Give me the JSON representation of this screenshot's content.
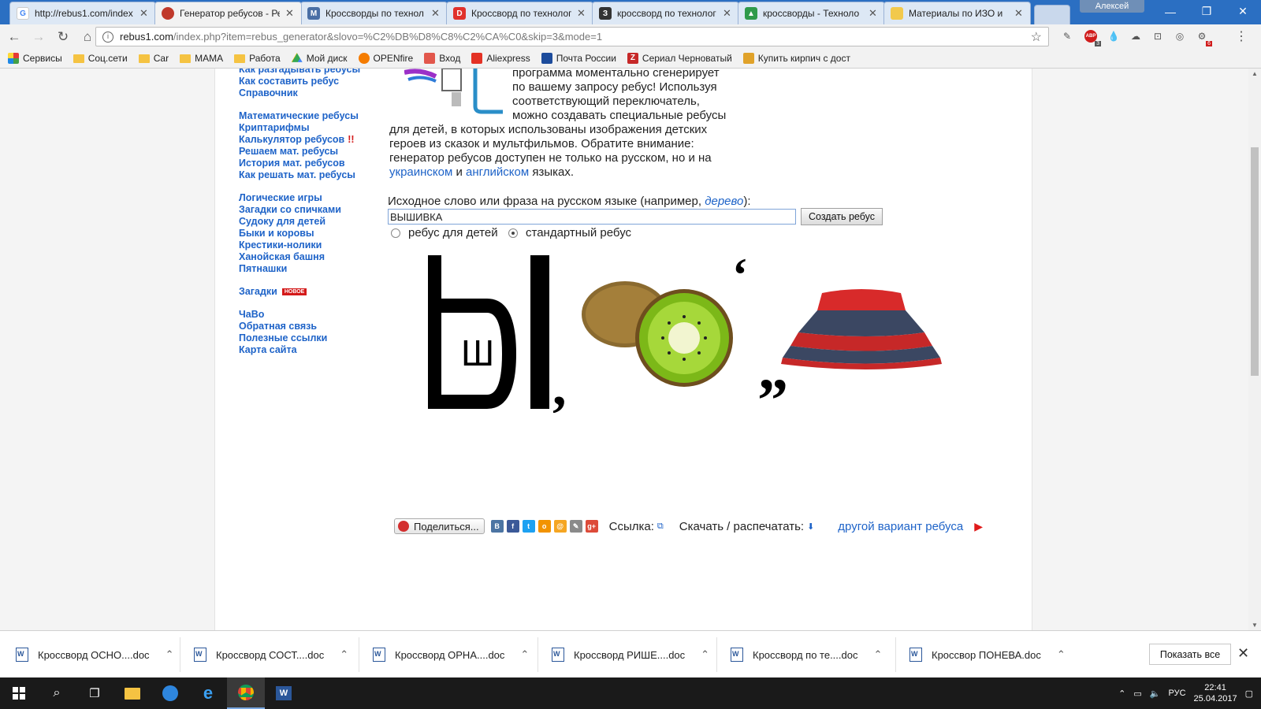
{
  "tabs": [
    {
      "title": "http://rebus1.com/index",
      "icon": "google-icon",
      "color": "#4285f4"
    },
    {
      "title": "Генератор ребусов - Ре",
      "icon": "rebus-site-icon",
      "color": "#c0392b"
    },
    {
      "title": "Кроссворды по технол",
      "icon": "m-site-icon",
      "color": "#4a6fa5"
    },
    {
      "title": "Кроссворд по технолог",
      "icon": "d-site-icon",
      "color": "#e0312c"
    },
    {
      "title": "кроссворд по технолог",
      "icon": "z-site-icon",
      "color": "#333333"
    },
    {
      "title": "кроссворды - Техноло",
      "icon": "triangle-site-icon",
      "color": "#2f9a4b"
    },
    {
      "title": "Материалы по ИЗО и",
      "icon": "doc-site-icon",
      "color": "#f2c94c"
    }
  ],
  "window": {
    "user": "Алексей"
  },
  "address": {
    "host": "rebus1.com",
    "rest": "/index.php?item=rebus_generator&slovo=%C2%DB%D8%C8%C2%CA%C0&skip=3&mode=1"
  },
  "bookmarks": [
    {
      "label": "Сервисы",
      "icon": "apps-icon"
    },
    {
      "label": "Соц.сети",
      "icon": "folder-icon"
    },
    {
      "label": "Car",
      "icon": "folder-icon"
    },
    {
      "label": "MAMA",
      "icon": "folder-icon"
    },
    {
      "label": "Работа",
      "icon": "folder-icon"
    },
    {
      "label": "Мой диск",
      "icon": "drive-icon"
    },
    {
      "label": "OPENfire",
      "icon": "fire-icon"
    },
    {
      "label": "Вход",
      "icon": "mail-icon"
    },
    {
      "label": "Aliexpress",
      "icon": "ali-icon"
    },
    {
      "label": "Почта России",
      "icon": "eagle-icon"
    },
    {
      "label": "Сериал Черноватый",
      "icon": "z-icon"
    },
    {
      "label": "Купить кирпич с дост",
      "icon": "brick-icon"
    }
  ],
  "extensions": {
    "abp_count": "3",
    "badge_count": "6"
  },
  "nav": {
    "group1": [
      "Как разгадывать ребусы",
      "Как составить ребус",
      "Справочник"
    ],
    "group2": [
      "Математические ребусы",
      "Криптарифмы",
      "Калькулятор ребусов",
      "Решаем мат. ребусы",
      "История мат. ребусов",
      "Как решать мат. ребусы"
    ],
    "calc_mark": "!!",
    "group3": [
      "Логические игры",
      "Загадки со спичками",
      "Судоку для детей",
      "Быки и коровы",
      "Крестики-нолики",
      "Ханойская башня",
      "Пятнашки"
    ],
    "riddles": "Загадки",
    "new_badge": "НОВОЕ",
    "group4": [
      "ЧаВо",
      "Обратная связь",
      "Полезные ссылки",
      "Карта сайта"
    ]
  },
  "intro": {
    "line1": "программа моментально сгенерирует",
    "line2": "по вашему запросу ребус! Используя",
    "line3": "соответствующий переключатель,",
    "line4": "можно создавать специальные ребусы",
    "line5": "для детей, в которых использованы изображения детских",
    "line6": "героев из сказок и мультфильмов. Обратите внимание:",
    "line7": "генератор ребусов доступен не только на русском, но и на",
    "link_ukr": "украинском",
    "and": "и",
    "link_eng": "английском",
    "tail": "языках."
  },
  "form": {
    "label_start": "Исходное слово или фраза на русском языке (например, ",
    "example": "дерево",
    "label_end": "):",
    "input_value": "ВЫШИВКА",
    "button": "Создать ребус",
    "radio_kids": "ребус для детей",
    "radio_std": "стандартный ребус",
    "selected": "std"
  },
  "rebus": {
    "big_letter": "Ы",
    "small_letter": "Ш"
  },
  "share": {
    "button": "Поделиться...",
    "link_label": "Ссылка:",
    "download_label": "Скачать / распечатать:",
    "other": "другой вариант ребуса"
  },
  "downloads": [
    "Кроссворд ОСНО....doc",
    "Кроссворд СОСТ....doc",
    "Кроссворд ОРНА....doc",
    "Кроссворд РИШЕ....doc",
    "Кроссворд по те....doc",
    "Кроссвор ПОНЕВА.doc"
  ],
  "show_all": "Показать все",
  "taskbar": {
    "lang": "РУС",
    "time": "22:41",
    "date": "25.04.2017"
  }
}
